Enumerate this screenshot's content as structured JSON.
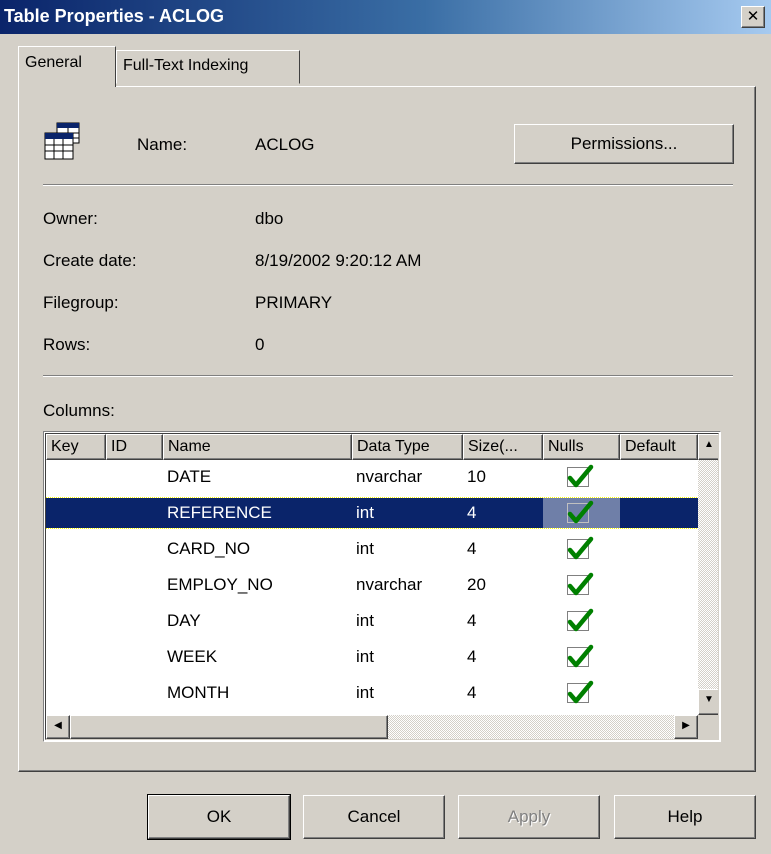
{
  "window": {
    "title": "Table Properties - ACLOG",
    "close_symbol": "✕"
  },
  "tabs": [
    {
      "label": "General",
      "active": true
    },
    {
      "label": "Full-Text Indexing",
      "active": false
    }
  ],
  "general": {
    "table_icon": "table-icon",
    "name_label": "Name:",
    "name_value": "ACLOG",
    "permissions_button": "Permissions...",
    "owner_label": "Owner:",
    "owner_value": "dbo",
    "create_date_label": "Create date:",
    "create_date_value": "8/19/2002 9:20:12 AM",
    "filegroup_label": "Filegroup:",
    "filegroup_value": "PRIMARY",
    "rows_label": "Rows:",
    "rows_value": "0",
    "columns_label": "Columns:"
  },
  "columns_list": {
    "headers": [
      "Key",
      "ID",
      "Name",
      "Data Type",
      "Size(...",
      "Nulls",
      "Default"
    ],
    "rows": [
      {
        "key": "",
        "id": "",
        "name": "DATE",
        "type": "nvarchar",
        "size": "10",
        "nulls": true,
        "selected": false
      },
      {
        "key": "",
        "id": "",
        "name": "REFERENCE",
        "type": "int",
        "size": "4",
        "nulls": true,
        "selected": true
      },
      {
        "key": "",
        "id": "",
        "name": "CARD_NO",
        "type": "int",
        "size": "4",
        "nulls": true,
        "selected": false
      },
      {
        "key": "",
        "id": "",
        "name": "EMPLOY_NO",
        "type": "nvarchar",
        "size": "20",
        "nulls": true,
        "selected": false
      },
      {
        "key": "",
        "id": "",
        "name": "DAY",
        "type": "int",
        "size": "4",
        "nulls": true,
        "selected": false
      },
      {
        "key": "",
        "id": "",
        "name": "WEEK",
        "type": "int",
        "size": "4",
        "nulls": true,
        "selected": false
      },
      {
        "key": "",
        "id": "",
        "name": "MONTH",
        "type": "int",
        "size": "4",
        "nulls": true,
        "selected": false
      }
    ],
    "check_color": "#008000",
    "selected_color": "#0a246a"
  },
  "buttons": {
    "ok": "OK",
    "cancel": "Cancel",
    "apply": "Apply",
    "help": "Help"
  },
  "colors": {
    "dialog_bg": "#d4d0c8",
    "title_bar_start": "#0a246a",
    "title_bar_end": "#a6caf0"
  }
}
